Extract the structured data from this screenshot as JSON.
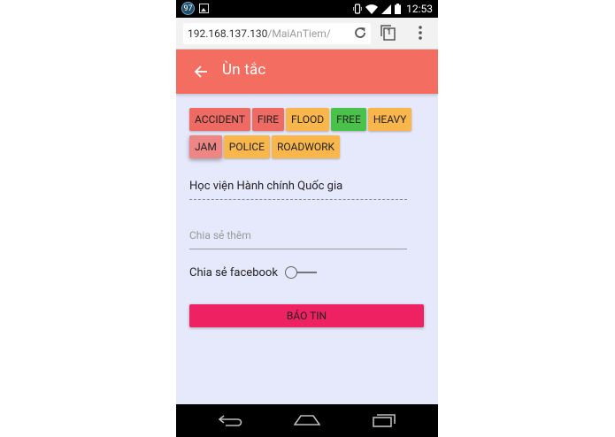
{
  "statusbar": {
    "notification_count": "97",
    "time": "12:53",
    "icons": [
      "notification-badge-icon",
      "image-icon",
      "vibrate-icon",
      "wifi-icon",
      "signal-icon",
      "battery-icon"
    ]
  },
  "browser": {
    "url_host": "192.168.137.130",
    "url_path": "/MaiAnTiem/",
    "tab_count": "1"
  },
  "toolbar": {
    "title": "Ùn tắc",
    "background": "#f36d61"
  },
  "chips": {
    "row1": [
      {
        "label": "ACCIDENT",
        "color": "#ef6a62"
      },
      {
        "label": "FIRE",
        "color": "#ef6a62"
      },
      {
        "label": "FLOOD",
        "color": "#f9b74b"
      },
      {
        "label": "FREE",
        "color": "#49c24a"
      },
      {
        "label": "HEAVY",
        "color": "#f9b74b"
      }
    ],
    "row2": [
      {
        "label": "JAM",
        "color": "#ee8686"
      },
      {
        "label": "POLICE",
        "color": "#f9b74b"
      },
      {
        "label": "ROADWORK",
        "color": "#f9b74b"
      }
    ]
  },
  "form": {
    "location_value": "Học viện Hành chính Quốc gia",
    "share_placeholder": "Chia sẻ thêm",
    "facebook_label": "Chia sẻ facebook",
    "facebook_enabled": false,
    "submit_label": "BÁO TIN",
    "submit_color": "#ee2163"
  }
}
